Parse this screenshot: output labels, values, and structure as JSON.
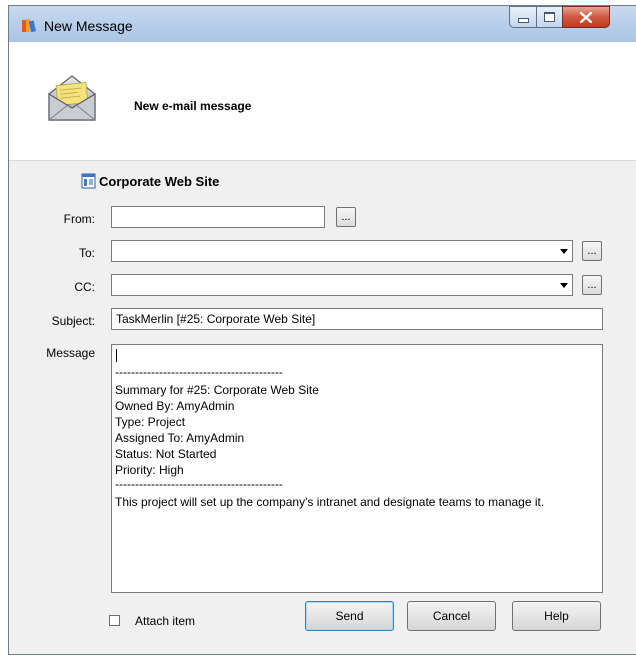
{
  "window": {
    "title": "New Message"
  },
  "header": {
    "title": "New e-mail message"
  },
  "project": {
    "title": "Corporate Web Site"
  },
  "form": {
    "from_label": "From:",
    "from_value": "",
    "to_label": "To:",
    "to_value": "",
    "cc_label": "CC:",
    "cc_value": "",
    "subject_label": "Subject:",
    "subject_value": "TaskMerlin [#25: Corporate Web Site]",
    "message_label": "Message",
    "browse_label": "..."
  },
  "message_body": {
    "separator1": "------------------------------------------",
    "summary": "Summary for #25: Corporate Web Site",
    "owned_by": "Owned By: AmyAdmin",
    "type": "Type: Project",
    "assigned_to": "Assigned To: AmyAdmin",
    "status": "Status: Not Started",
    "priority": "Priority: High",
    "separator2": "------------------------------------------",
    "description": "This project will set up the company's intranet and designate teams to manage it."
  },
  "footer": {
    "attach_label": "Attach item",
    "attach_checked": false,
    "send_label": "Send",
    "cancel_label": "Cancel",
    "help_label": "Help"
  },
  "icons": {
    "app": "app-books-icon",
    "envelope": "envelope-icon",
    "project": "project-document-icon"
  }
}
